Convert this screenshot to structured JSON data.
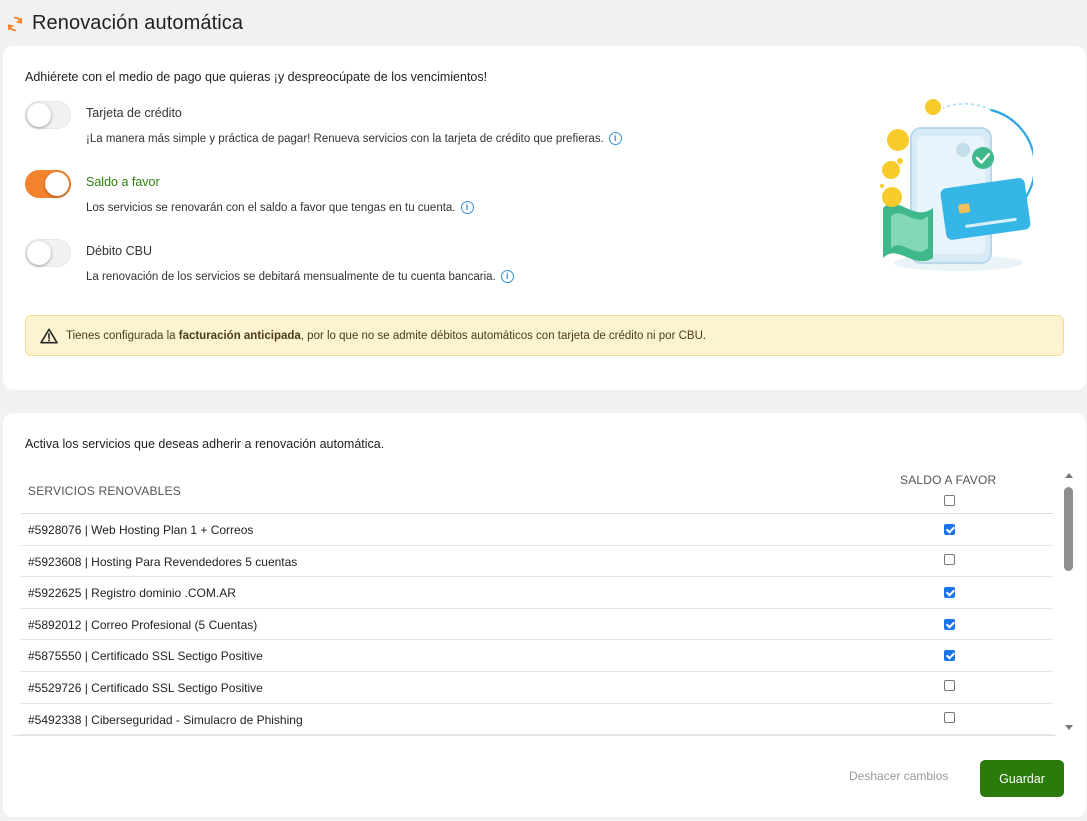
{
  "header": {
    "title": "Renovación automática",
    "icon": "refresh-icon"
  },
  "payment": {
    "intro": "Adhiérete con el medio de pago que quieras ¡y despreocúpate de los vencimientos!",
    "options": [
      {
        "title": "Tarjeta de crédito",
        "description": "¡La manera más simple y práctica de pagar! Renueva servicios con la tarjeta de crédito que prefieras.",
        "enabled": false
      },
      {
        "title": "Saldo a favor",
        "description": "Los servicios se renovarán con el saldo a favor que tengas en tu cuenta.",
        "enabled": true
      },
      {
        "title": "Débito CBU",
        "description": "La renovación de los servicios se debitará mensualmente de tu cuenta bancaria.",
        "enabled": false
      }
    ],
    "alert": {
      "prefix": "Tienes configurada la ",
      "highlight": "facturación anticipada",
      "suffix": ", por lo que no se admite débitos automáticos con tarjeta de crédito ni por CBU."
    },
    "info_glyph": "i"
  },
  "services": {
    "intro": "Activa los servicios que deseas adherir a renovación automática.",
    "column_services": "SERVICIOS RENOVABLES",
    "column_saldo": "SALDO A FAVOR",
    "rows": [
      {
        "label": "#5928076 | Web Hosting Plan 1 + Correos",
        "checked": true
      },
      {
        "label": "#5923608 | Hosting Para Revendedores 5 cuentas",
        "checked": false
      },
      {
        "label": "#5922625 | Registro dominio .COM.AR",
        "checked": true
      },
      {
        "label": "#5892012 | Correo Profesional (5 Cuentas)",
        "checked": true
      },
      {
        "label": "#5875550 | Certificado SSL Sectigo Positive",
        "checked": true
      },
      {
        "label": "#5529726 | Certificado SSL Sectigo Positive",
        "checked": false
      },
      {
        "label": "#5492338 | Ciberseguridad - Simulacro de Phishing",
        "checked": false
      }
    ]
  },
  "actions": {
    "undo_label": "Deshacer cambios",
    "save_label": "Guardar"
  },
  "colors": {
    "accent": "#f5822c",
    "primary": "#2c7a0c",
    "active_text": "#2e7d0f",
    "alert_bg": "#fdf3d0"
  }
}
